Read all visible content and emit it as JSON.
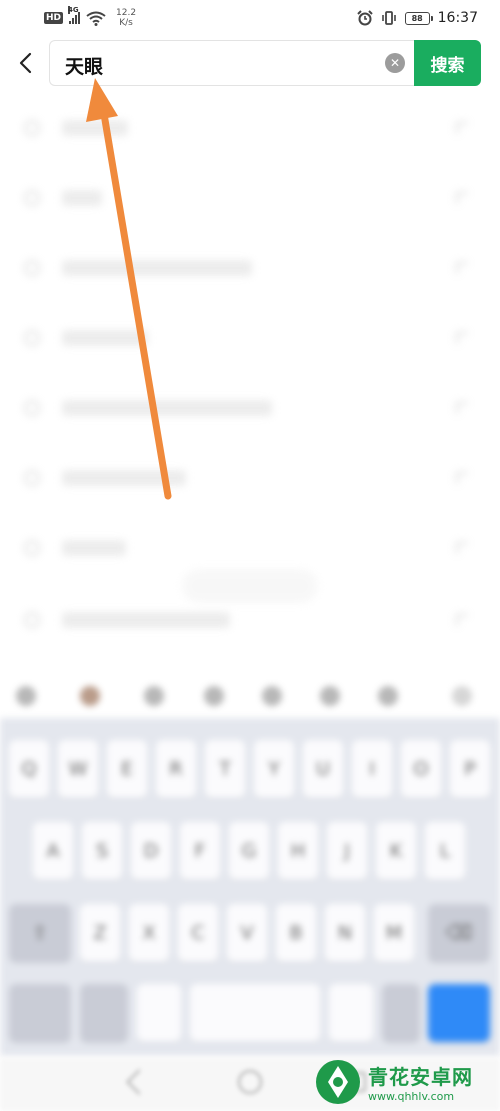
{
  "status_bar": {
    "hd_badge": "HD",
    "network": "4G",
    "speed_value": "12.2",
    "speed_unit": "K/s",
    "battery": "88",
    "time": "16:37"
  },
  "search": {
    "query": "天眼",
    "button_label": "搜索"
  },
  "icons": {
    "back": "back-arrow-icon",
    "clear": "clear-icon",
    "annotation": "orange-arrow"
  },
  "colors": {
    "search_button": "#1aad5f",
    "annotation_arrow": "#f08a3c",
    "watermark_green": "#1f9a4a"
  },
  "watermark": {
    "title": "青花安卓网",
    "url": "www.qhhlv.com"
  }
}
